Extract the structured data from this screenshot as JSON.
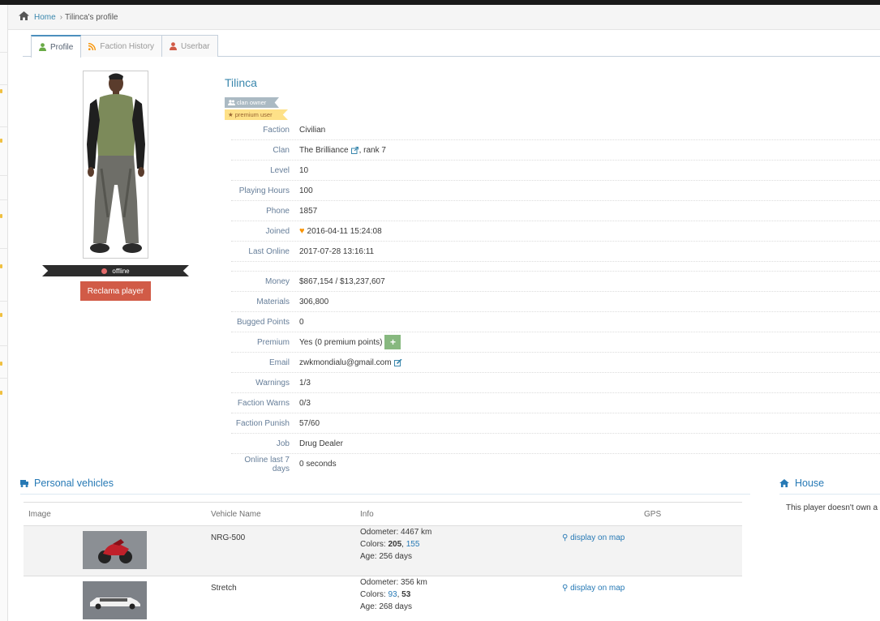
{
  "breadcrumb": {
    "home": "Home",
    "current": "Tilinca's profile"
  },
  "tabs": [
    {
      "label": "Profile",
      "icon": "user-icon",
      "color": "#69aa46"
    },
    {
      "label": "Faction History",
      "icon": "rss-icon",
      "color": "#f89406"
    },
    {
      "label": "Userbar",
      "icon": "user-icon",
      "color": "#d15b47"
    }
  ],
  "player": {
    "name": "Tilinca",
    "badges": [
      {
        "text": "clan owner",
        "icon": "users-icon"
      },
      {
        "text": "premium user",
        "icon": "star-icon"
      }
    ],
    "status": "offline",
    "action_button": "Reclama player"
  },
  "info": {
    "faction": {
      "label": "Faction",
      "value": "Civilian"
    },
    "clan": {
      "label": "Clan",
      "name": "The Brilliance",
      "rank": ", rank 7"
    },
    "level": {
      "label": "Level",
      "value": "10"
    },
    "hours": {
      "label": "Playing Hours",
      "value": "100"
    },
    "phone": {
      "label": "Phone",
      "value": "1857"
    },
    "joined": {
      "label": "Joined",
      "value": "2016-04-11 15:24:08"
    },
    "last_online": {
      "label": "Last Online",
      "value": "2017-07-28 13:16:11"
    },
    "money": {
      "label": "Money",
      "value": "$867,154 / $13,237,607"
    },
    "materials": {
      "label": "Materials",
      "value": "306,800"
    },
    "bugged": {
      "label": "Bugged Points",
      "value": "0"
    },
    "premium": {
      "label": "Premium",
      "value": "Yes (0 premium points)",
      "button": "+"
    },
    "email": {
      "label": "Email",
      "value": "zwkmondialu@gmail.com"
    },
    "warnings": {
      "label": "Warnings",
      "value": "1/3"
    },
    "faction_warns": {
      "label": "Faction Warns",
      "value": "0/3"
    },
    "faction_punish": {
      "label": "Faction Punish",
      "value": "57/60"
    },
    "job": {
      "label": "Job",
      "value": "Drug Dealer"
    },
    "online7": {
      "label": "Online last 7 days",
      "value": "0 seconds"
    }
  },
  "vehicles": {
    "title": "Personal vehicles",
    "columns": [
      "Image",
      "Vehicle Name",
      "Info",
      "GPS"
    ],
    "rows": [
      {
        "name": "NRG-500",
        "odometer_label": "Odometer:",
        "odometer": "4467 km",
        "colors_label": "Colors:",
        "color1": "205",
        "color2": "155",
        "age_label": "Age:",
        "age": "256 days",
        "gps": "display on map"
      },
      {
        "name": "Stretch",
        "odometer_label": "Odometer:",
        "odometer": "356 km",
        "colors_label": "Colors:",
        "color1": "93",
        "color2": "53",
        "age_label": "Age:",
        "age": "268 days",
        "gps": "display on map"
      }
    ]
  },
  "house": {
    "title": "House",
    "text": "This player doesn't own a"
  }
}
